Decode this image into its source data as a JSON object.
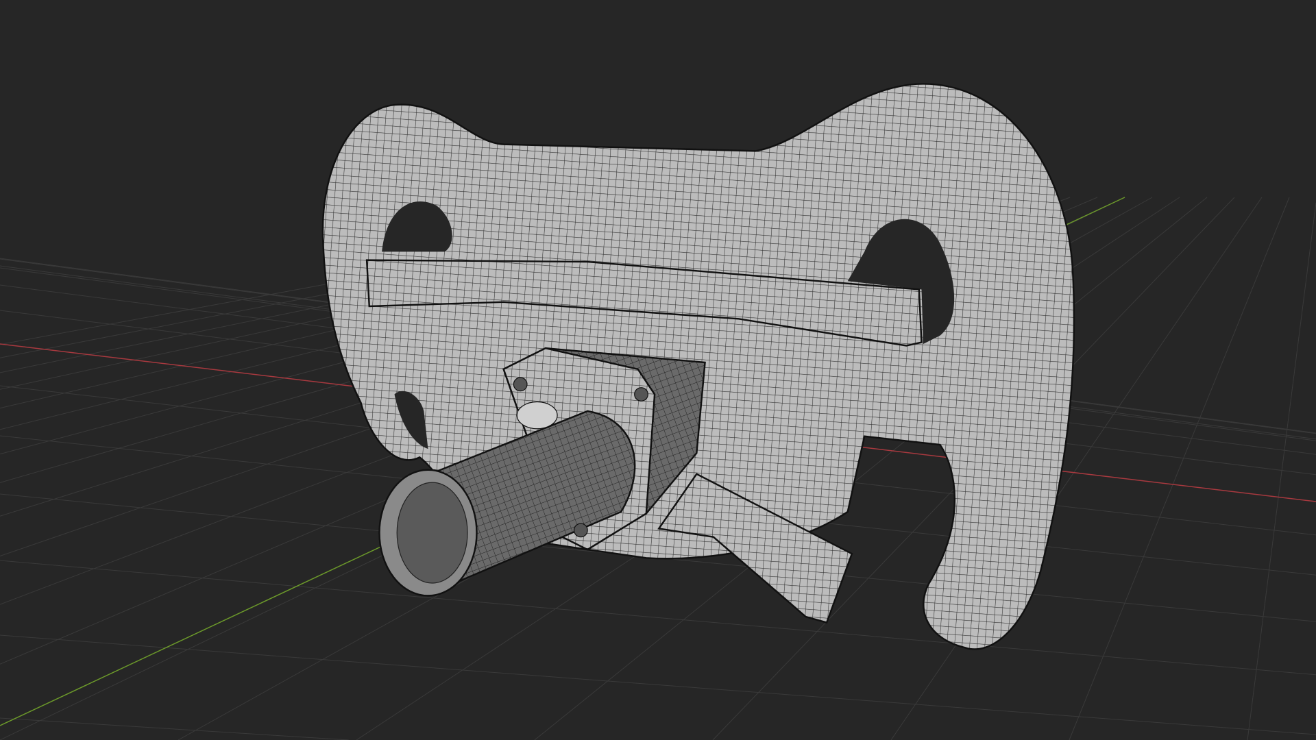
{
  "viewport": {
    "mode": "wireframe-overlay",
    "object": "steering-wheel",
    "colors": {
      "background": "#262626",
      "grid": "#3a3a3a",
      "x_axis": "#a8393f",
      "y_axis": "#6c9a2a",
      "mesh_fill": "#b9b9b9",
      "mesh_wire": "#2b2b2b",
      "hub_fill": "#6a6a6a"
    }
  }
}
